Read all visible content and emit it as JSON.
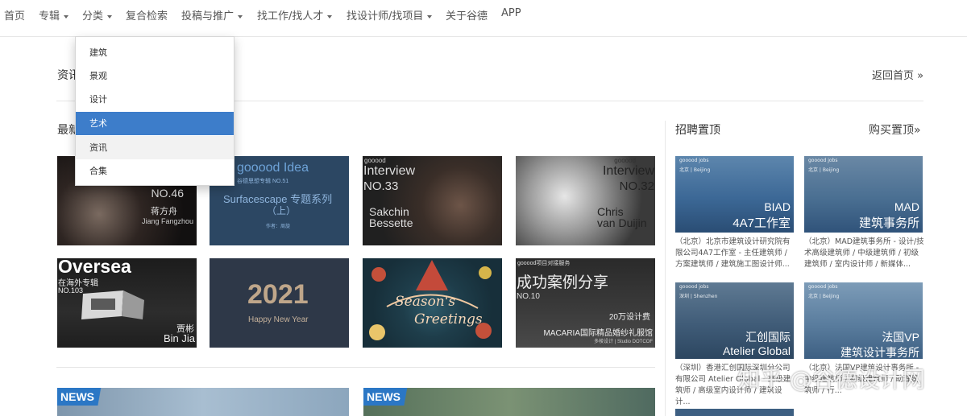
{
  "nav": {
    "home": "首页",
    "special": "专辑",
    "category": "分类",
    "search": "复合检索",
    "submit": "投稿与推广",
    "jobs": "找工作/找人才",
    "designers": "找设计师/找项目",
    "about": "关于谷德",
    "app": "APP"
  },
  "dropdown": {
    "items": [
      "建筑",
      "景观",
      "设计",
      "艺术",
      "资讯",
      "合集"
    ],
    "active": "艺术",
    "hover": "资讯"
  },
  "page": {
    "section_title": "资讯",
    "back_home": "返回首页 »",
    "latest_label": "最新"
  },
  "tiles": [
    {
      "line1": "NO.46",
      "line2": "蒋方舟",
      "line3": "Jiang Fangzhou"
    },
    {
      "line1": "gooood Idea",
      "line2": "谷德思想专辑 NO.51",
      "line3": "Surfacescape 专题系列",
      "line4": "（上）",
      "line5": "作者：周旋"
    },
    {
      "line1": "gooood",
      "line2": "Interview",
      "line3": "NO.33",
      "line4": "Sakchin",
      "line5": "Bessette"
    },
    {
      "line1": "gooood",
      "line2": "Interview",
      "line3": "NO.32",
      "line4": "Chris",
      "line5": "van Duijin"
    },
    {
      "line1": "Oversea",
      "line2": "在海外专辑",
      "line3": "NO.103",
      "line4": "贾彬",
      "line5": "Bin Jia"
    },
    {
      "line1": "2021",
      "line2": "Happy New Year"
    },
    {
      "line1": "Season's",
      "line2": "Greetings"
    },
    {
      "line1": "gooood项目对接服务",
      "line2": "成功案例分享",
      "line3": "NO.10",
      "line4": "20万设计费",
      "line5": "MACARIA国际精品婚纱礼服馆",
      "line6": "多棱设计 | Studio DOTCOF"
    }
  ],
  "jobs": {
    "title": "招聘置顶",
    "buy": "购买置顶»",
    "cards": [
      {
        "tag": "gooood jobs",
        "loc": "北京 | Beijing",
        "big1": "BIAD",
        "big2": "4A7工作室",
        "desc": "（北京）北京市建筑设计研究院有限公司4A7工作室 - 主任建筑师 / 方案建筑师 / 建筑施工图设计师..."
      },
      {
        "tag": "gooood jobs",
        "loc": "北京 | Beijing",
        "big1": "MAD",
        "big2": "建筑事务所",
        "desc": "（北京）MAD建筑事务所 - 设计/技术高级建筑师 / 中级建筑师 / 初级建筑师 / 室内设计师 / 新媒体..."
      },
      {
        "tag": "gooood jobs",
        "loc": "深圳 | Shenzhen",
        "big1": "汇创国际",
        "big2": "Atelier Global",
        "desc": "（深圳）香港汇创国际深圳分公司有限公司 Atelier Global - 高级建筑师 / 高级室内设计师 / 建筑设计..."
      },
      {
        "tag": "gooood jobs",
        "loc": "北京 | Beijing",
        "big1": "法国VP",
        "big2": "建筑设计事务所",
        "desc": "（北京）法国VP建筑设计事务所 - 中级建筑师 / 初级建筑师 / 助理建筑师 / 行..."
      }
    ]
  },
  "news": {
    "badge": "NEWS"
  },
  "watermark": "知乎 @谷德设计网"
}
